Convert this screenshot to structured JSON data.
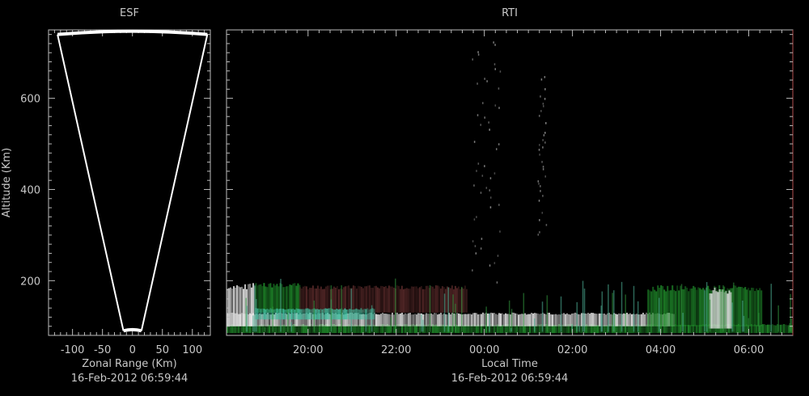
{
  "esf": {
    "title": "ESF",
    "xlabel": "Zonal Range (Km)",
    "ylabel": "Altitude (Km)",
    "timestamp": "16-Feb-2012 06:59:44",
    "xlim": [
      -140,
      130
    ],
    "ylim": [
      80,
      750
    ],
    "xticks": [
      -100,
      -50,
      0,
      50,
      100
    ],
    "xtick_labels": [
      "-100",
      "-50",
      "0",
      "50",
      "100"
    ],
    "yticks": [
      200,
      400,
      600
    ],
    "ytick_labels": [
      "200",
      "400",
      "600"
    ]
  },
  "rti": {
    "title": "RTI",
    "xlabel": "Local Time",
    "timestamp": "16-Feb-2012 06:59:44",
    "xlim": [
      18.15,
      31.0
    ],
    "ylim": [
      80,
      750
    ],
    "xticks": [
      20,
      22,
      24,
      26,
      28,
      30
    ],
    "xtick_labels": [
      "20:00",
      "22:00",
      "00:00",
      "02:00",
      "04:00",
      "06:00"
    ],
    "yticks": [
      200,
      400,
      600
    ]
  },
  "chart_data": [
    {
      "type": "line",
      "panel": "esf",
      "title": "ESF",
      "xlabel": "Zonal Range (Km)",
      "ylabel": "Altitude (Km)",
      "xlim": [
        -140,
        130
      ],
      "ylim": [
        80,
        750
      ],
      "series": [
        {
          "x": [
            -125,
            -15,
            15,
            125
          ],
          "y": [
            740,
            90,
            90,
            740
          ]
        }
      ],
      "arcs": [
        {
          "altitude": 740,
          "x_from": -125,
          "x_to": 125
        },
        {
          "altitude": 90,
          "x_from": -15,
          "x_to": 15
        }
      ],
      "grid": false
    },
    {
      "type": "heatmap",
      "panel": "rti",
      "title": "RTI",
      "xlabel": "Local Time",
      "xlim": [
        18.15,
        31.0
      ],
      "ylim": [
        80,
        750
      ],
      "x_ticks": [
        "20:00",
        "22:00",
        "00:00",
        "02:00",
        "04:00",
        "06:00"
      ],
      "y_ticks": [
        200,
        400,
        600
      ],
      "grid": false,
      "colors": {
        "background": "#000000",
        "green": "#1f8a2a",
        "cyan": "#3fbfa0",
        "white": "#e8e8e8",
        "maroon": "#5a2a2a",
        "gray": "#8a8a8a"
      },
      "features": [
        {
          "name": "E-region layer",
          "x_from": 18.15,
          "x_to": 31.0,
          "alt_from": 85,
          "alt_to": 105,
          "color": "green"
        },
        {
          "name": "bright echo band",
          "x_from": 18.15,
          "x_to": 28.3,
          "alt_from": 100,
          "alt_to": 130,
          "color": "white"
        },
        {
          "name": "early evening echo",
          "x_from": 18.15,
          "x_to": 18.8,
          "alt_from": 100,
          "alt_to": 195,
          "color": "white"
        },
        {
          "name": "green echo 19h",
          "x_from": 18.8,
          "x_to": 19.8,
          "alt_from": 130,
          "alt_to": 195,
          "color": "green"
        },
        {
          "name": "maroon echo 20-23h",
          "x_from": 19.8,
          "x_to": 23.6,
          "alt_from": 130,
          "alt_to": 190,
          "color": "maroon"
        },
        {
          "name": "cyan streak",
          "x_from": 18.8,
          "x_to": 21.5,
          "alt_from": 115,
          "alt_to": 140,
          "color": "cyan"
        },
        {
          "name": "green echo 04-06h",
          "x_from": 27.7,
          "x_to": 30.3,
          "alt_from": 100,
          "alt_to": 190,
          "color": "green"
        },
        {
          "name": "white echo 05h",
          "x_from": 29.1,
          "x_to": 29.6,
          "alt_from": 95,
          "alt_to": 185,
          "color": "white"
        },
        {
          "name": "plume 00h",
          "x_from": 23.7,
          "x_to": 24.4,
          "alt_from": 190,
          "alt_to": 730,
          "color": "gray"
        },
        {
          "name": "plume 01h",
          "x_from": 25.2,
          "x_to": 25.4,
          "alt_from": 300,
          "alt_to": 670,
          "color": "gray"
        }
      ]
    }
  ]
}
